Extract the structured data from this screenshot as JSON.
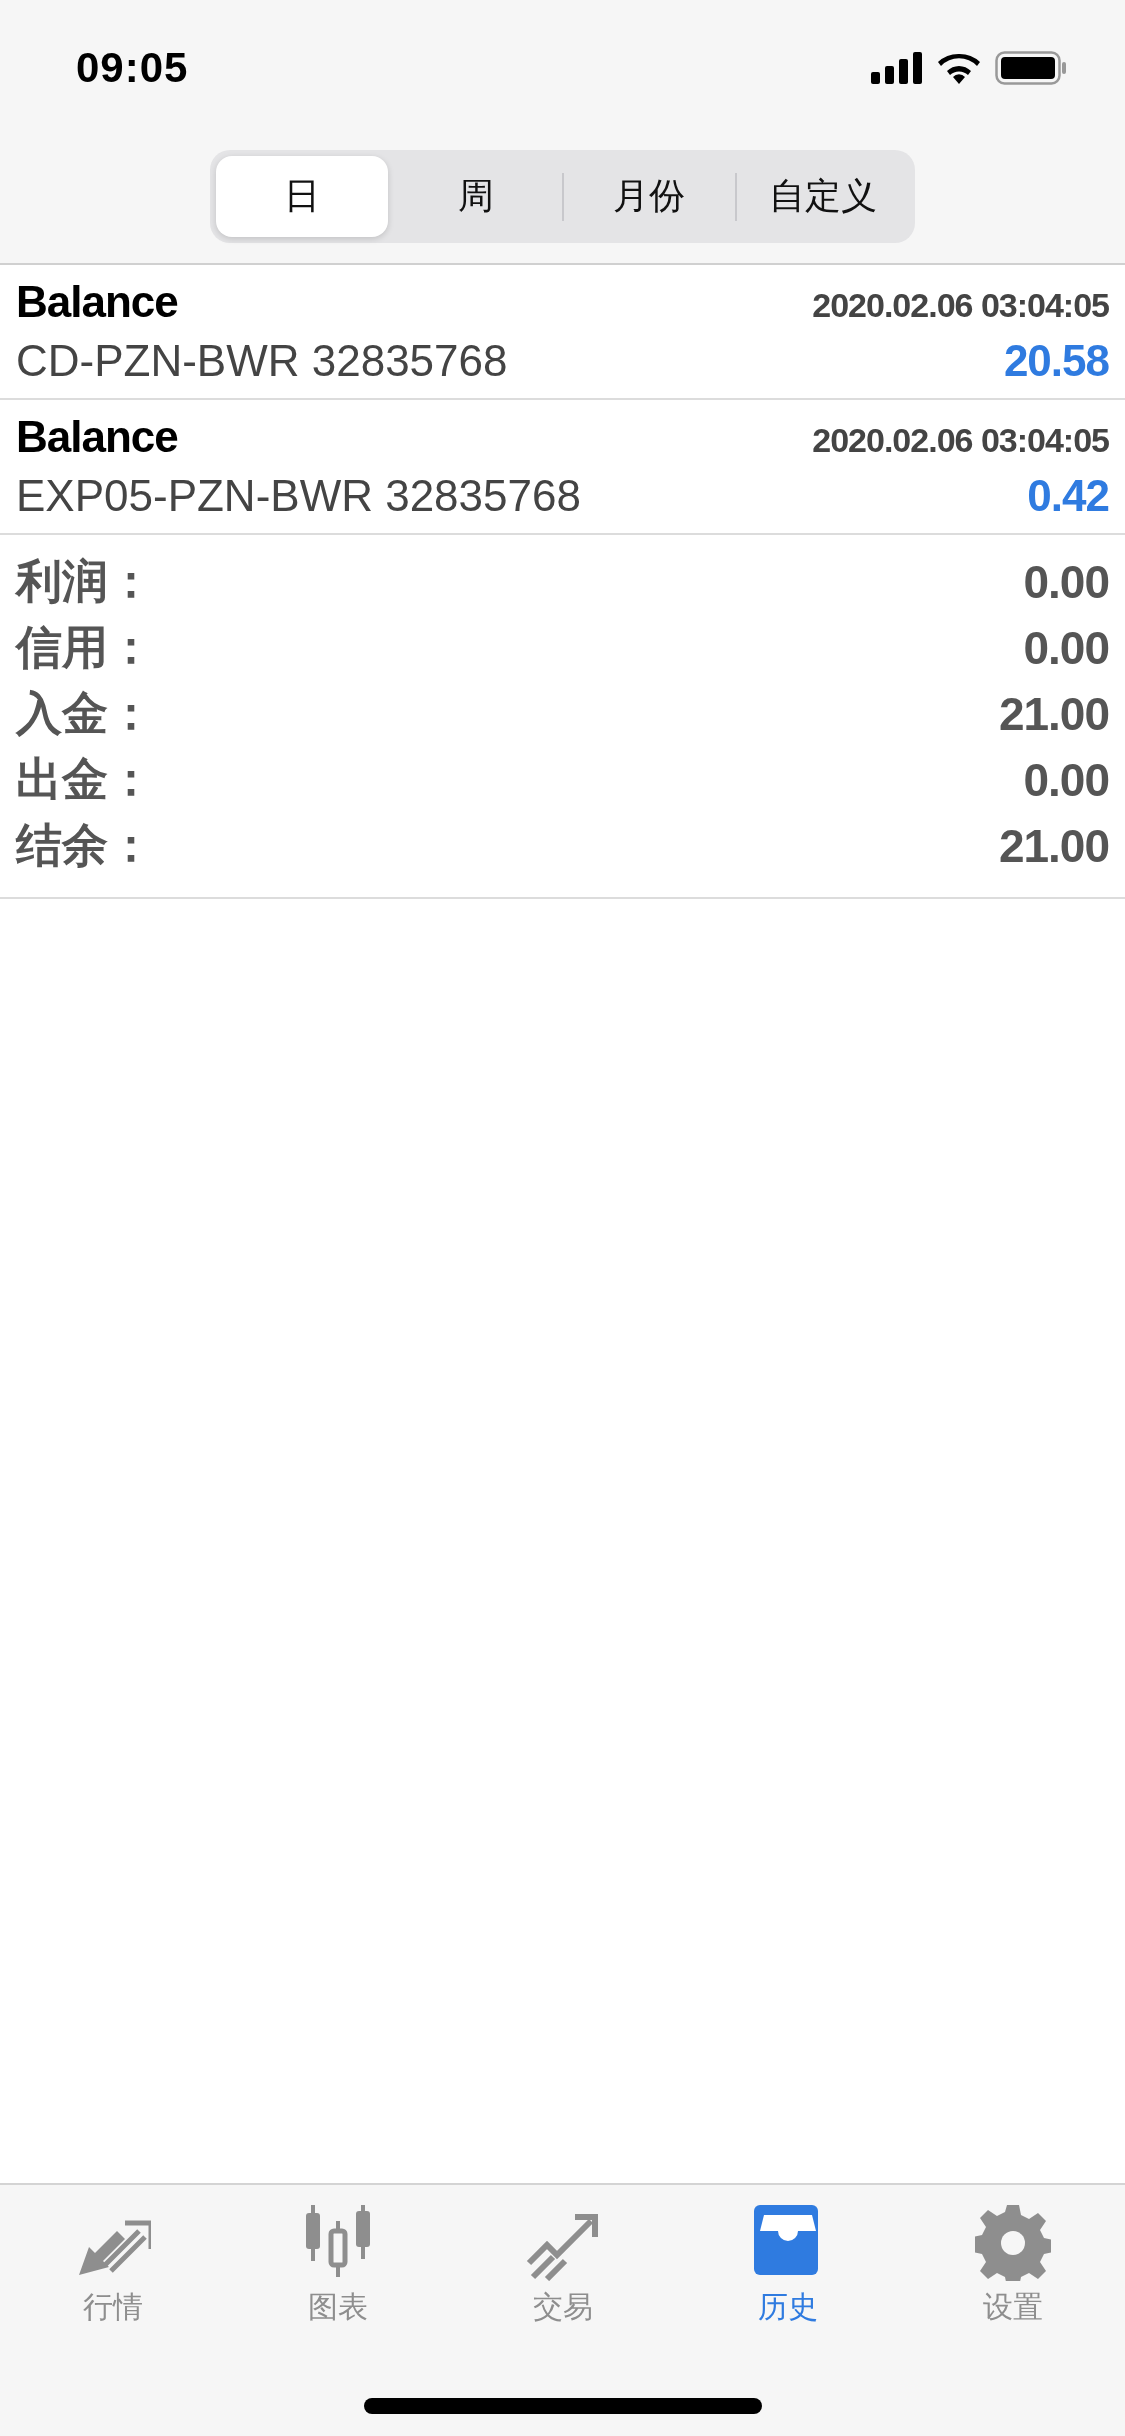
{
  "status_bar": {
    "time": "09:05"
  },
  "segments": [
    {
      "label": "日",
      "selected": true
    },
    {
      "label": "周",
      "selected": false
    },
    {
      "label": "月份",
      "selected": false
    },
    {
      "label": "自定义",
      "selected": false
    }
  ],
  "entries": [
    {
      "type": "Balance",
      "time": "2020.02.06 03:04:05",
      "comment": "CD-PZN-BWR 32835768",
      "amount": "20.58"
    },
    {
      "type": "Balance",
      "time": "2020.02.06 03:04:05",
      "comment": "EXP05-PZN-BWR 32835768",
      "amount": "0.42"
    }
  ],
  "summary": [
    {
      "label": "利润：",
      "value": "0.00"
    },
    {
      "label": "信用：",
      "value": "0.00"
    },
    {
      "label": "入金：",
      "value": "21.00"
    },
    {
      "label": "出金：",
      "value": "0.00"
    },
    {
      "label": "结余：",
      "value": "21.00"
    }
  ],
  "tab_bar": [
    {
      "label": "行情",
      "selected": false
    },
    {
      "label": "图表",
      "selected": false
    },
    {
      "label": "交易",
      "selected": false
    },
    {
      "label": "历史",
      "selected": true
    },
    {
      "label": "设置",
      "selected": false
    }
  ]
}
